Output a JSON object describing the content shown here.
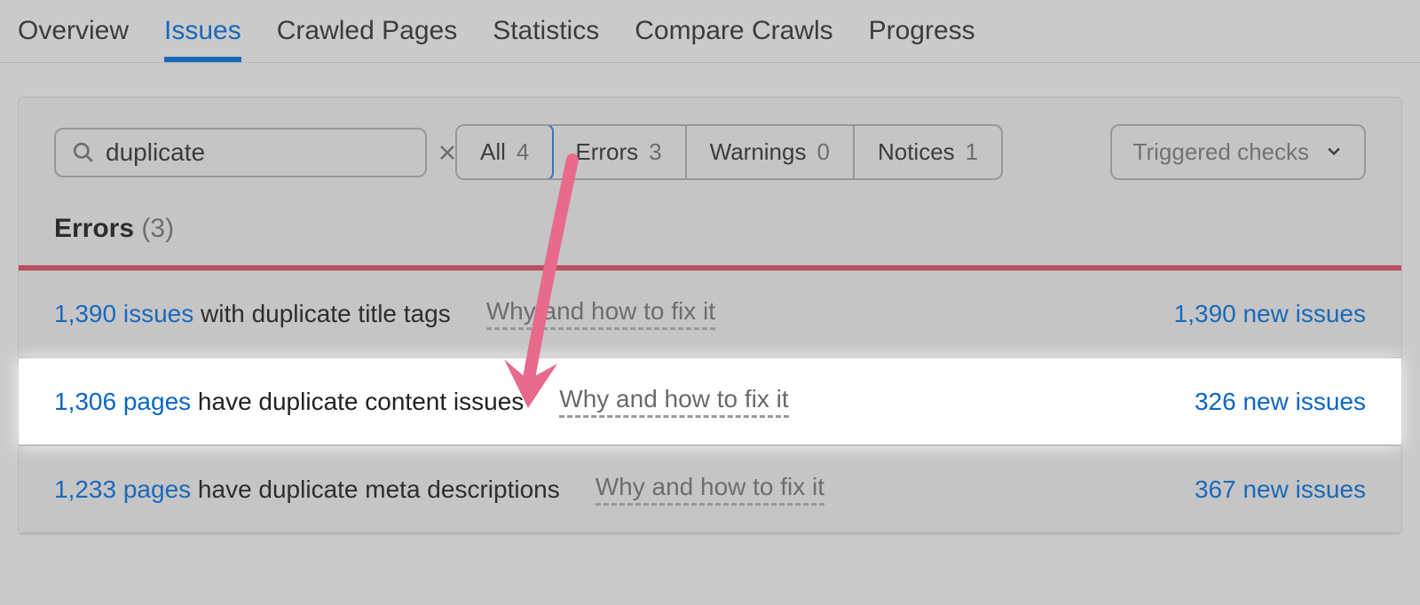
{
  "tabs": {
    "overview": "Overview",
    "issues": "Issues",
    "crawled": "Crawled Pages",
    "statistics": "Statistics",
    "compare": "Compare Crawls",
    "progress": "Progress"
  },
  "search": {
    "value": "duplicate"
  },
  "filters": {
    "all_label": "All",
    "all_count": "4",
    "errors_label": "Errors",
    "errors_count": "3",
    "warnings_label": "Warnings",
    "warnings_count": "0",
    "notices_label": "Notices",
    "notices_count": "1"
  },
  "dropdown": {
    "label": "Triggered checks"
  },
  "section": {
    "title": "Errors",
    "count": "(3)"
  },
  "help_link": "Why and how to fix it",
  "rows": [
    {
      "count": "1,390 issues",
      "text": " with duplicate title tags",
      "right": "1,390 new issues"
    },
    {
      "count": "1,306 pages",
      "text": " have duplicate content issues",
      "right": "326 new issues"
    },
    {
      "count": "1,233 pages",
      "text": " have duplicate meta descriptions",
      "right": "367 new issues"
    }
  ]
}
